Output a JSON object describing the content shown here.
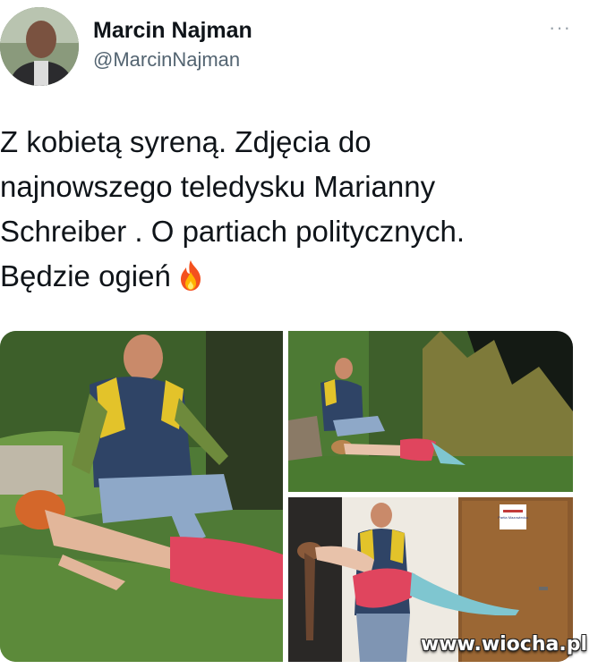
{
  "author": {
    "name": "Marcin Najman",
    "handle": "@MarcinNajman",
    "avatar_icon": "avatar-photo"
  },
  "more_menu": {
    "label": "···",
    "icon": "more-dots-icon"
  },
  "tweet": {
    "lines": [
      "Z kobietą syreną. Zdjęcia do",
      "najnowszego teledysku Marianny",
      "Schreiber . O partiach politycznych.",
      "Będzie ogień"
    ],
    "emoji": "fire-emoji"
  },
  "media": {
    "photos": [
      {
        "subject": "man-and-mermaid-on-grass-closeup"
      },
      {
        "subject": "man-and-mermaid-by-reeds"
      },
      {
        "subject": "man-carrying-mermaid-indoors"
      }
    ],
    "door_sign_text": "Partia Mazowiecka"
  },
  "watermark": "www.wiocha.pl",
  "colors": {
    "text": "#0f1419",
    "secondary": "#536471",
    "tail_pink": "#e0455e",
    "tail_teal": "#7fc6d0",
    "vest_blue": "#2f4466",
    "vest_yellow": "#e3c32a"
  }
}
